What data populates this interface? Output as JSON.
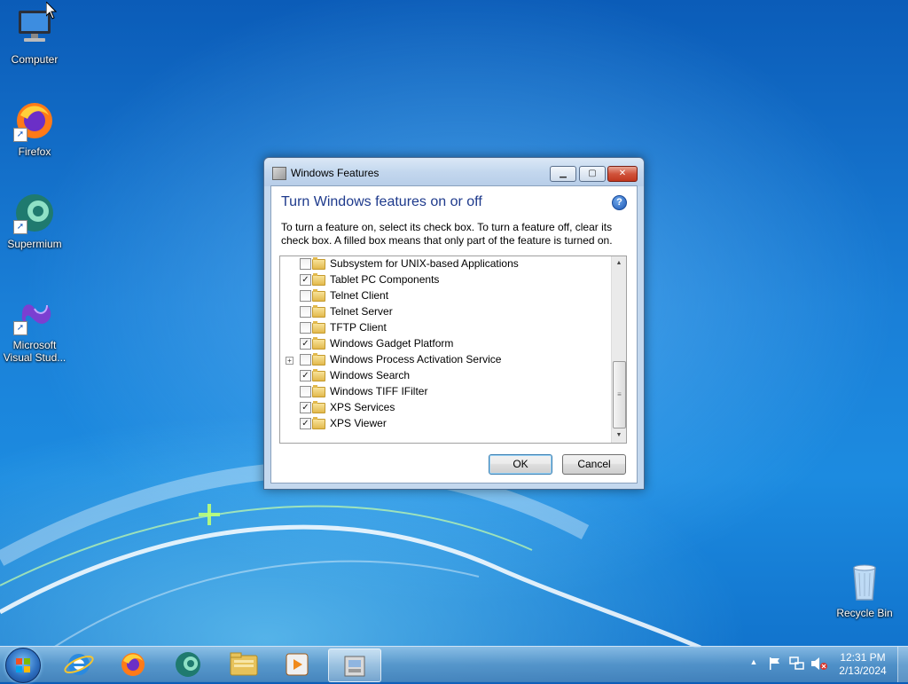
{
  "desktop": {
    "icons": [
      {
        "label": "Computer",
        "icon": "computer-icon"
      },
      {
        "label": "Firefox",
        "icon": "firefox-icon"
      },
      {
        "label": "Supermium",
        "icon": "supermium-icon"
      },
      {
        "label": "Microsoft Visual Stud...",
        "label_line1": "Microsoft",
        "label_line2": "Visual Stud...",
        "icon": "visual-studio-icon"
      },
      {
        "label": "Recycle Bin",
        "icon": "recycle-bin-icon"
      }
    ]
  },
  "dialog": {
    "title": "Windows Features",
    "heading": "Turn Windows features on or off",
    "description": "To turn a feature on, select its check box. To turn a feature off, clear its check box. A filled box means that only part of the feature is turned on.",
    "help_glyph": "?",
    "features": [
      {
        "label": "Subsystem for UNIX-based Applications",
        "checked": false,
        "expandable": false
      },
      {
        "label": "Tablet PC Components",
        "checked": true,
        "expandable": false
      },
      {
        "label": "Telnet Client",
        "checked": false,
        "expandable": false
      },
      {
        "label": "Telnet Server",
        "checked": false,
        "expandable": false
      },
      {
        "label": "TFTP Client",
        "checked": false,
        "expandable": false
      },
      {
        "label": "Windows Gadget Platform",
        "checked": true,
        "expandable": false
      },
      {
        "label": "Windows Process Activation Service",
        "checked": false,
        "expandable": true
      },
      {
        "label": "Windows Search",
        "checked": true,
        "expandable": false
      },
      {
        "label": "Windows TIFF IFilter",
        "checked": false,
        "expandable": false
      },
      {
        "label": "XPS Services",
        "checked": true,
        "expandable": false
      },
      {
        "label": "XPS Viewer",
        "checked": true,
        "expandable": false
      }
    ],
    "ok_label": "OK",
    "cancel_label": "Cancel"
  },
  "taskbar": {
    "apps": [
      "internet-explorer-icon",
      "firefox-icon",
      "supermium-icon",
      "windows-explorer-icon",
      "media-player-icon",
      "windows-features-icon"
    ],
    "active_app": "windows-features-icon",
    "tray_icons": [
      "show-hidden-icons-icon",
      "action-center-flag-icon",
      "network-icon",
      "volume-muted-icon"
    ],
    "time": "12:31 PM",
    "date": "2/13/2024"
  },
  "colors": {
    "heading": "#1e3a8c",
    "desktop_blue": "#1a7fd7",
    "close_red": "#c2381f"
  }
}
